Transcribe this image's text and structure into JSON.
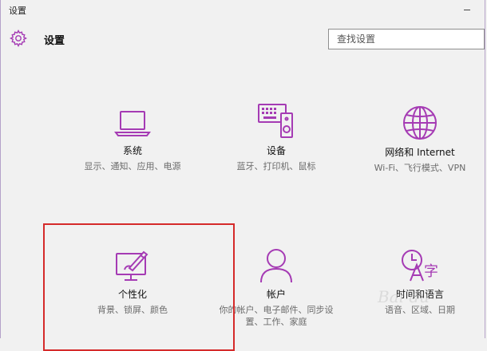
{
  "window": {
    "title": "设置"
  },
  "header": {
    "title": "设置",
    "gear_icon": "gear-icon"
  },
  "search": {
    "placeholder": "查找设置",
    "value": ""
  },
  "tiles": [
    {
      "icon": "laptop-icon",
      "label": "系统",
      "desc": "显示、通知、应用、电源"
    },
    {
      "icon": "devices-icon",
      "label": "设备",
      "desc": "蓝牙、打印机、鼠标"
    },
    {
      "icon": "globe-icon",
      "label": "网络和 Internet",
      "desc": "Wi-Fi、飞行模式、VPN"
    },
    {
      "icon": "personalization-icon",
      "label": "个性化",
      "desc": "背景、锁屏、颜色"
    },
    {
      "icon": "person-icon",
      "label": "帐户",
      "desc": "你的帐户、电子邮件、同步设置、工作、家庭"
    },
    {
      "icon": "time-language-icon",
      "label": "时间和语言",
      "desc": "语音、区域、日期"
    }
  ],
  "colors": {
    "accent": "#a53bb4",
    "highlight": "#d52a2a",
    "background": "#f1f1f1"
  },
  "watermark": "Bai du"
}
